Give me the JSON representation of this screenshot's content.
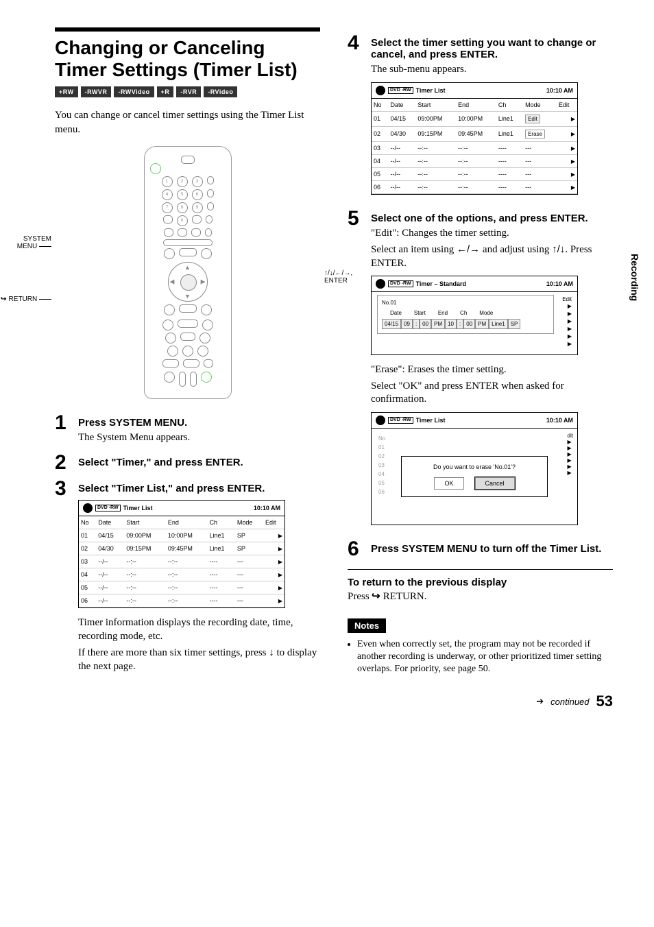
{
  "side_tab": "Recording",
  "title": "Changing or Canceling Timer Settings (Timer List)",
  "format_badges": [
    "+RW",
    "-RWVR",
    "-RWVideo",
    "+R",
    "-RVR",
    "-RVideo"
  ],
  "intro": "You can change or cancel timer settings using the Timer List menu.",
  "remote_labels": {
    "system_menu": "SYSTEM MENU",
    "return": "RETURN",
    "enter": "↑/↓/←/→, ENTER"
  },
  "steps": {
    "s1": {
      "title": "Press SYSTEM MENU.",
      "body": "The System Menu appears."
    },
    "s2": {
      "title": "Select \"Timer,\" and press ENTER."
    },
    "s3": {
      "title": "Select \"Timer List,\" and press ENTER.",
      "after": "Timer information displays the recording date, time, recording mode, etc.",
      "after2": "If there are more than six timer settings, press ↓ to display the next page."
    },
    "s4": {
      "title": "Select the timer setting you want to change or cancel, and press ENTER.",
      "body": "The sub-menu appears."
    },
    "s5": {
      "title": "Select one of the options, and press ENTER.",
      "edit_line": "\"Edit\": Changes the timer setting.",
      "edit_body": "Select an item using ←/→ and adjust using ↑/↓. Press ENTER.",
      "erase_line": "\"Erase\": Erases the timer setting.",
      "erase_body": "Select \"OK\" and press ENTER when asked for confirmation."
    },
    "s6": {
      "title": "Press SYSTEM MENU to turn off the Timer List."
    }
  },
  "osd_common": {
    "disc_label": "DVD\n-RW",
    "title_timer_list": "Timer List",
    "title_timer_std": "Timer – Standard",
    "clock": "10:10 AM",
    "columns": [
      "No",
      "Date",
      "Start",
      "End",
      "Ch",
      "Mode",
      "Edit"
    ]
  },
  "timer_rows": [
    {
      "no": "01",
      "date": "04/15",
      "start": "09:00PM",
      "end": "10:00PM",
      "ch": "Line1",
      "mode": "SP"
    },
    {
      "no": "02",
      "date": "04/30",
      "start": "09:15PM",
      "end": "09:45PM",
      "ch": "Line1",
      "mode": "SP"
    },
    {
      "no": "03",
      "date": "--/--",
      "start": "--:--",
      "end": "--:--",
      "ch": "----",
      "mode": "---"
    },
    {
      "no": "04",
      "date": "--/--",
      "start": "--:--",
      "end": "--:--",
      "ch": "----",
      "mode": "---"
    },
    {
      "no": "05",
      "date": "--/--",
      "start": "--:--",
      "end": "--:--",
      "ch": "----",
      "mode": "---"
    },
    {
      "no": "06",
      "date": "--/--",
      "start": "--:--",
      "end": "--:--",
      "ch": "----",
      "mode": "---"
    }
  ],
  "submenu": {
    "edit": "Edit",
    "erase": "Erase"
  },
  "edit_panel": {
    "no": "No.01",
    "labels": [
      "Date",
      "Start",
      "End",
      "Ch",
      "Mode"
    ],
    "cells": [
      "04/15",
      "09",
      ":",
      "00",
      "PM",
      "10",
      ":",
      "00",
      "PM",
      "Line1",
      "SP"
    ],
    "edit_col": "Edit"
  },
  "erase_dialog": {
    "question": "Do you want to erase 'No.01'?",
    "ok": "OK",
    "cancel": "Cancel"
  },
  "return_section": {
    "heading": "To return to the previous display",
    "body": "Press      RETURN."
  },
  "notes_label": "Notes",
  "notes": [
    "Even when correctly set, the program may not be recorded if another recording is underway, or other prioritized timer setting overlaps. For priority, see page 50."
  ],
  "footer": {
    "continued": "continued",
    "page": "53"
  }
}
